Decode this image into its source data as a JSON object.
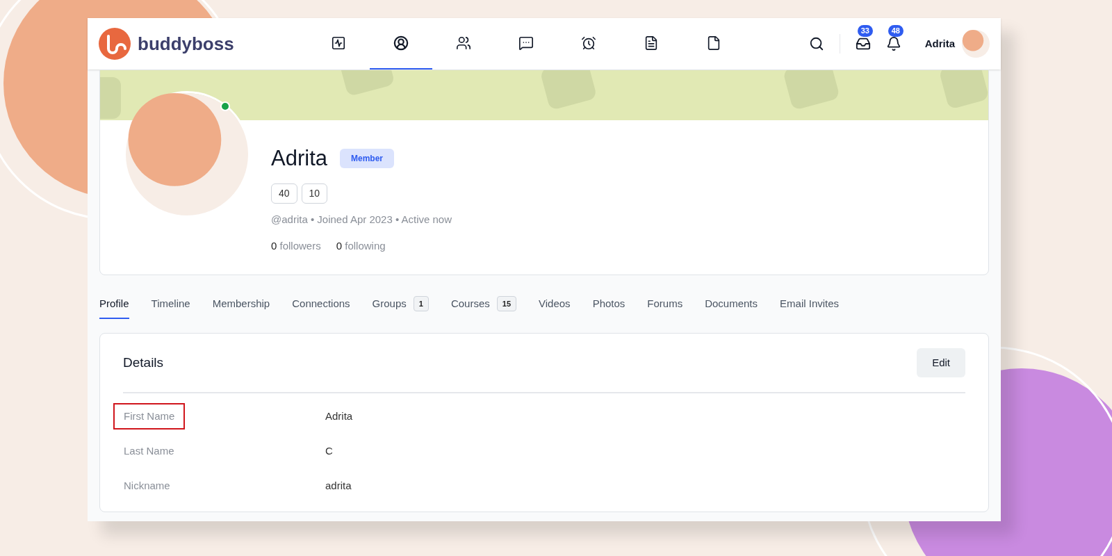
{
  "header": {
    "logo_text": "buddyboss",
    "nav_items": [
      {
        "kind": "activity",
        "selected": false
      },
      {
        "kind": "profile",
        "selected": true
      },
      {
        "kind": "members",
        "selected": false
      },
      {
        "kind": "messages",
        "selected": false
      },
      {
        "kind": "alarm",
        "selected": false
      },
      {
        "kind": "document",
        "selected": false
      },
      {
        "kind": "file",
        "selected": false
      }
    ],
    "inbox_badge": "33",
    "notifications_badge": "48",
    "user_name": "Adrita"
  },
  "profile": {
    "name": "Adrita",
    "badge": "Member",
    "online": true,
    "counts": [
      "40",
      "10"
    ],
    "meta": "@adrita • Joined Apr 2023 • Active now",
    "followers": {
      "count": "0",
      "label": "followers"
    },
    "following": {
      "count": "0",
      "label": "following"
    }
  },
  "tabs": [
    {
      "label": "Profile",
      "selected": true
    },
    {
      "label": "Timeline",
      "selected": false
    },
    {
      "label": "Membership",
      "selected": false
    },
    {
      "label": "Connections",
      "selected": false
    },
    {
      "label": "Groups",
      "count": "1",
      "selected": false
    },
    {
      "label": "Courses",
      "count": "15",
      "selected": false
    },
    {
      "label": "Videos",
      "selected": false
    },
    {
      "label": "Photos",
      "selected": false
    },
    {
      "label": "Forums",
      "selected": false
    },
    {
      "label": "Documents",
      "selected": false
    },
    {
      "label": "Email Invites",
      "selected": false
    }
  ],
  "details": {
    "title": "Details",
    "edit_button": "Edit",
    "fields": [
      {
        "label": "First Name",
        "value": "Adrita",
        "highlighted": true
      },
      {
        "label": "Last Name",
        "value": "C",
        "highlighted": false
      },
      {
        "label": "Nickname",
        "value": "adrita",
        "highlighted": false
      }
    ]
  }
}
